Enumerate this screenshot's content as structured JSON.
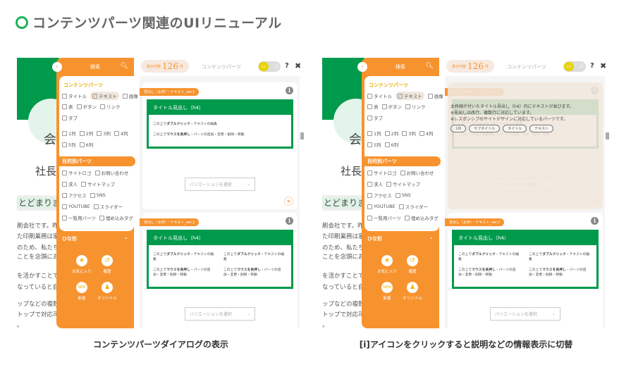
{
  "page_title": "コンテンツパーツ関連のUIリニューアル",
  "captions": [
    "コンテンツパーツダイアログの表示",
    "[i]アイコンをクリックすると説明などの情報表示に切替"
  ],
  "colors": {
    "accent_orange": "#f7932f",
    "brand_green": "#009a4c",
    "toggle_yellow": "#e8d200"
  },
  "background_page": {
    "circle_text": "会",
    "president": "社長",
    "highlight": "とどまりませ",
    "lines": [
      "刷会社です。昨今",
      "た印刷業務は家庭",
      "のため、私たちに",
      "ことを念頭にお",
      "を活かすことで今",
      "なっていると自負",
      "ップなどの複数",
      "トップで対応可能",
      "。"
    ]
  },
  "sidebar": {
    "search_label": "検索",
    "content_parts_heading": "コンテンツパーツ",
    "content_rows": [
      [
        {
          "label": "タイトル",
          "checked": false
        },
        {
          "label": "テキスト",
          "checked": true
        },
        {
          "label": "画像",
          "checked": false
        }
      ],
      [
        {
          "label": "表",
          "checked": false
        },
        {
          "label": "ボタン",
          "checked": false
        },
        {
          "label": "リンク",
          "checked": false
        }
      ],
      [
        {
          "label": "タブ",
          "checked": false
        }
      ],
      [
        {
          "label": "1列",
          "checked": false
        },
        {
          "label": "2列",
          "checked": false
        },
        {
          "label": "3列",
          "checked": false
        },
        {
          "label": "4列",
          "checked": false
        }
      ],
      [
        {
          "label": "5列",
          "checked": false
        },
        {
          "label": "6列",
          "checked": false
        }
      ]
    ],
    "purpose_heading": "目的別パーツ",
    "purpose_rows": [
      [
        {
          "label": "サイトロゴ",
          "checked": false
        },
        {
          "label": "お問い合わせ",
          "checked": false
        }
      ],
      [
        {
          "label": "求人",
          "checked": false
        },
        {
          "label": "サイトマップ",
          "checked": false
        }
      ],
      [
        {
          "label": "アクセス",
          "checked": false
        },
        {
          "label": "SNS",
          "checked": false
        }
      ],
      [
        {
          "label": "YOUTUBE",
          "checked": false
        },
        {
          "label": "スライダー",
          "checked": false
        }
      ],
      [
        {
          "label": "一覧用パーツ",
          "checked": false
        },
        {
          "label": "埋め込みタグ",
          "checked": false
        }
      ]
    ],
    "template_heading": "ひな形",
    "tiles": [
      {
        "label": "お気に入り",
        "icon": "star-icon",
        "glyph": "★"
      },
      {
        "label": "履歴",
        "icon": "history-icon",
        "glyph": "↺"
      },
      {
        "label": "新着",
        "icon": "new-badge-icon",
        "glyph": "NEW"
      },
      {
        "label": "オリジナル",
        "icon": "user-icon",
        "glyph": "♟"
      }
    ]
  },
  "header": {
    "count_prefix": "表示件数",
    "count": "126",
    "count_suffix": "件",
    "title": "コンテンツパーツ",
    "help": "?",
    "close": "✖"
  },
  "cards": [
    {
      "tag": "見出し（太枠）・テキスト_ver.1",
      "heading": "タイトル見出し（h4）",
      "line1_pre": "この上で",
      "line1_em": "ダブルクリック",
      "line1_post": "・テキストの編集",
      "line2_pre": "この上で",
      "line2_em": "マウスを長押し",
      "line2_post": "・パーツの追加・変更・削除・移動",
      "select": "バリエーションを選択"
    },
    {
      "tag": "見出し（太枠）・テキスト_ver.2",
      "heading": "タイトル見出し（h4）",
      "line1_pre": "この上で",
      "line1_em": "ダブルクリック",
      "line1_post": "・テキストの編集",
      "line2_pre": "この上で",
      "line2_em": "マウスを長押し",
      "line2_post": "・パーツの追加・変更・削除・移動",
      "select": "バリエーションを選択"
    }
  ],
  "info_overlay": {
    "lines": [
      "太枠線が付いたタイトル見出し（h4）内にテキストが並びます。",
      "※見出しは改行、複数行に対応しています。",
      "※レスポンシブのサイトデザインに対応しているパーツです。"
    ],
    "tags": [
      "1列",
      "サブタイトル",
      "タイトル",
      "テキスト"
    ]
  }
}
